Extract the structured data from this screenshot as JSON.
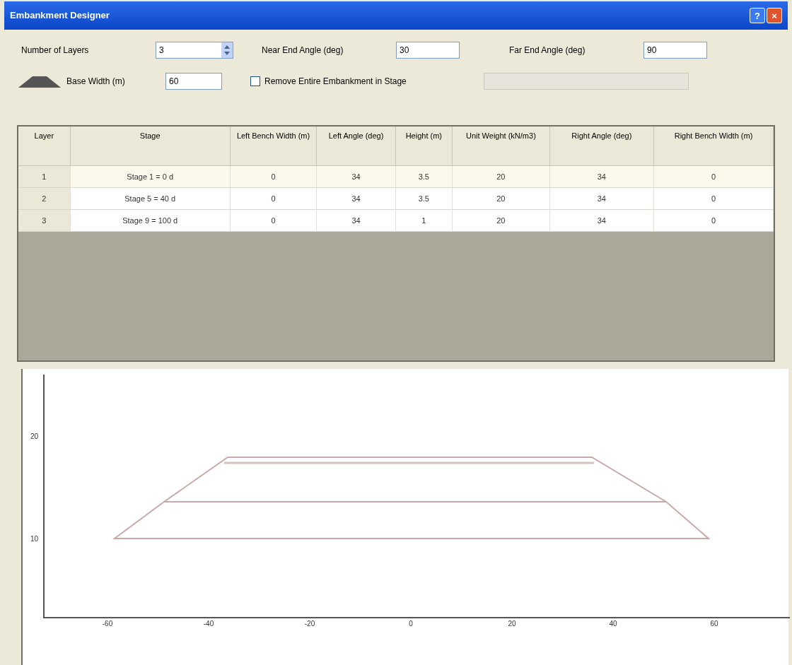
{
  "window": {
    "title": "Embankment Designer",
    "help_button": "?",
    "close_button": "×"
  },
  "form": {
    "layers_label": "Number of Layers",
    "layers_value": "3",
    "near_label": "Near End Angle (deg)",
    "near_value": "30",
    "far_label": "Far End Angle (deg)",
    "far_value": "90",
    "base_label": "Base Width (m)",
    "base_value": "60",
    "remove_label": "Remove Entire Embankment in Stage",
    "remove_checked": false,
    "stage_select": {
      "disabled": true
    }
  },
  "table": {
    "columns": [
      "Layer",
      "Stage",
      "Left Bench Width (m)",
      "Left Angle (deg)",
      "Height (m)",
      "Unit Weight (kN/m3)",
      "Right Angle (deg)",
      "Right Bench Width (m)"
    ],
    "rows": [
      {
        "selected": true,
        "cells": [
          "1",
          "Stage 1 = 0 d",
          "0",
          "34",
          "3.5",
          "20",
          "34",
          "0"
        ]
      },
      {
        "selected": false,
        "cells": [
          "2",
          "Stage 5 = 40 d",
          "0",
          "34",
          "3.5",
          "20",
          "34",
          "0"
        ]
      },
      {
        "selected": false,
        "cells": [
          "3",
          "Stage 9 = 100 d",
          "0",
          "34",
          "1",
          "20",
          "34",
          "0"
        ]
      }
    ]
  },
  "plot": {
    "y_labels": [
      "20",
      "10"
    ],
    "x_labels": [
      "-60",
      "-40",
      "-20",
      "0",
      "20",
      "40",
      "60"
    ]
  }
}
